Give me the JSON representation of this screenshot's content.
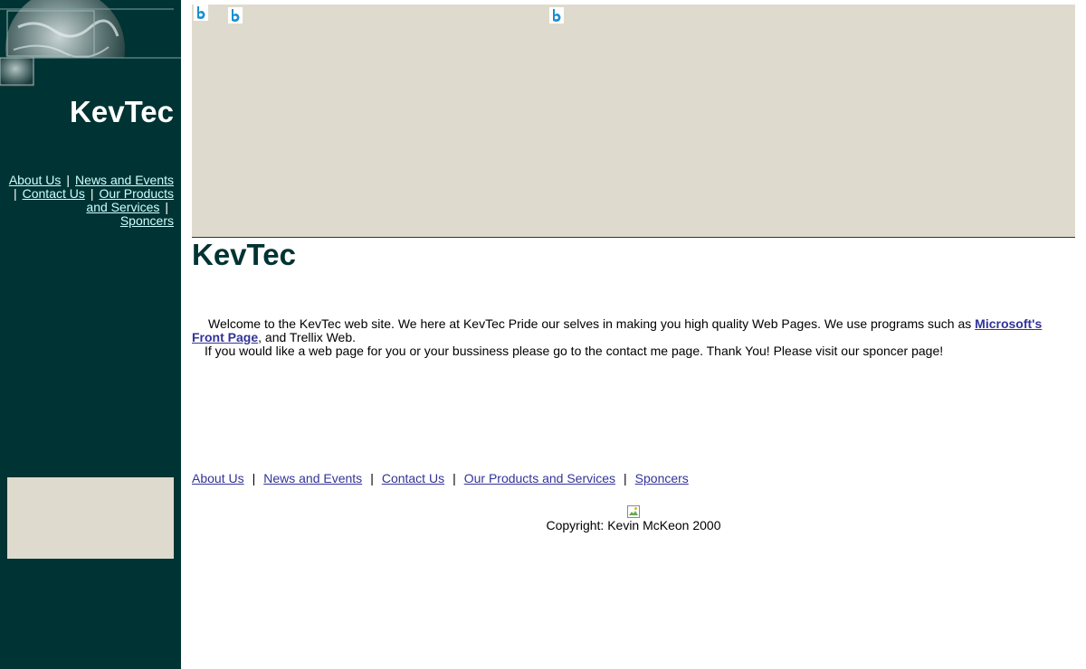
{
  "sidebar": {
    "title": "KevTec",
    "nav": [
      {
        "label": "About Us"
      },
      {
        "label": "News and Events"
      },
      {
        "label": "Contact Us"
      },
      {
        "label": "Our Products and Services"
      },
      {
        "label": "Sponcers"
      }
    ],
    "separator": "|"
  },
  "banner": {
    "icons": [
      "bing-b-icon",
      "bing-b-icon",
      "bing-b-icon"
    ]
  },
  "main": {
    "title": "KevTec",
    "intro": {
      "line1_before_link": "Welcome to the KevTec web site.  We here at KevTec Pride our selves in making you high quality Web Pages.  We use programs such as ",
      "link": "Microsoft's Front Page",
      "line1_after_link": ", and Trellix Web.",
      "line2": "If you would like a web page for you or your bussiness please go to the contact me page.  Thank You!  Please visit our sponcer page!"
    }
  },
  "footer": {
    "nav": [
      {
        "label": "About Us"
      },
      {
        "label": "News and Events"
      },
      {
        "label": "Contact Us"
      },
      {
        "label": "Our Products and Services"
      },
      {
        "label": "Sponcers"
      }
    ],
    "separator": "|",
    "copyright": "Copyright: Kevin McKeon 2000"
  },
  "colors": {
    "sidebar_bg": "#003333",
    "banner_bg": "#dedbce",
    "link": "#333399",
    "side_link": "#ccffff",
    "title": "#003333"
  }
}
